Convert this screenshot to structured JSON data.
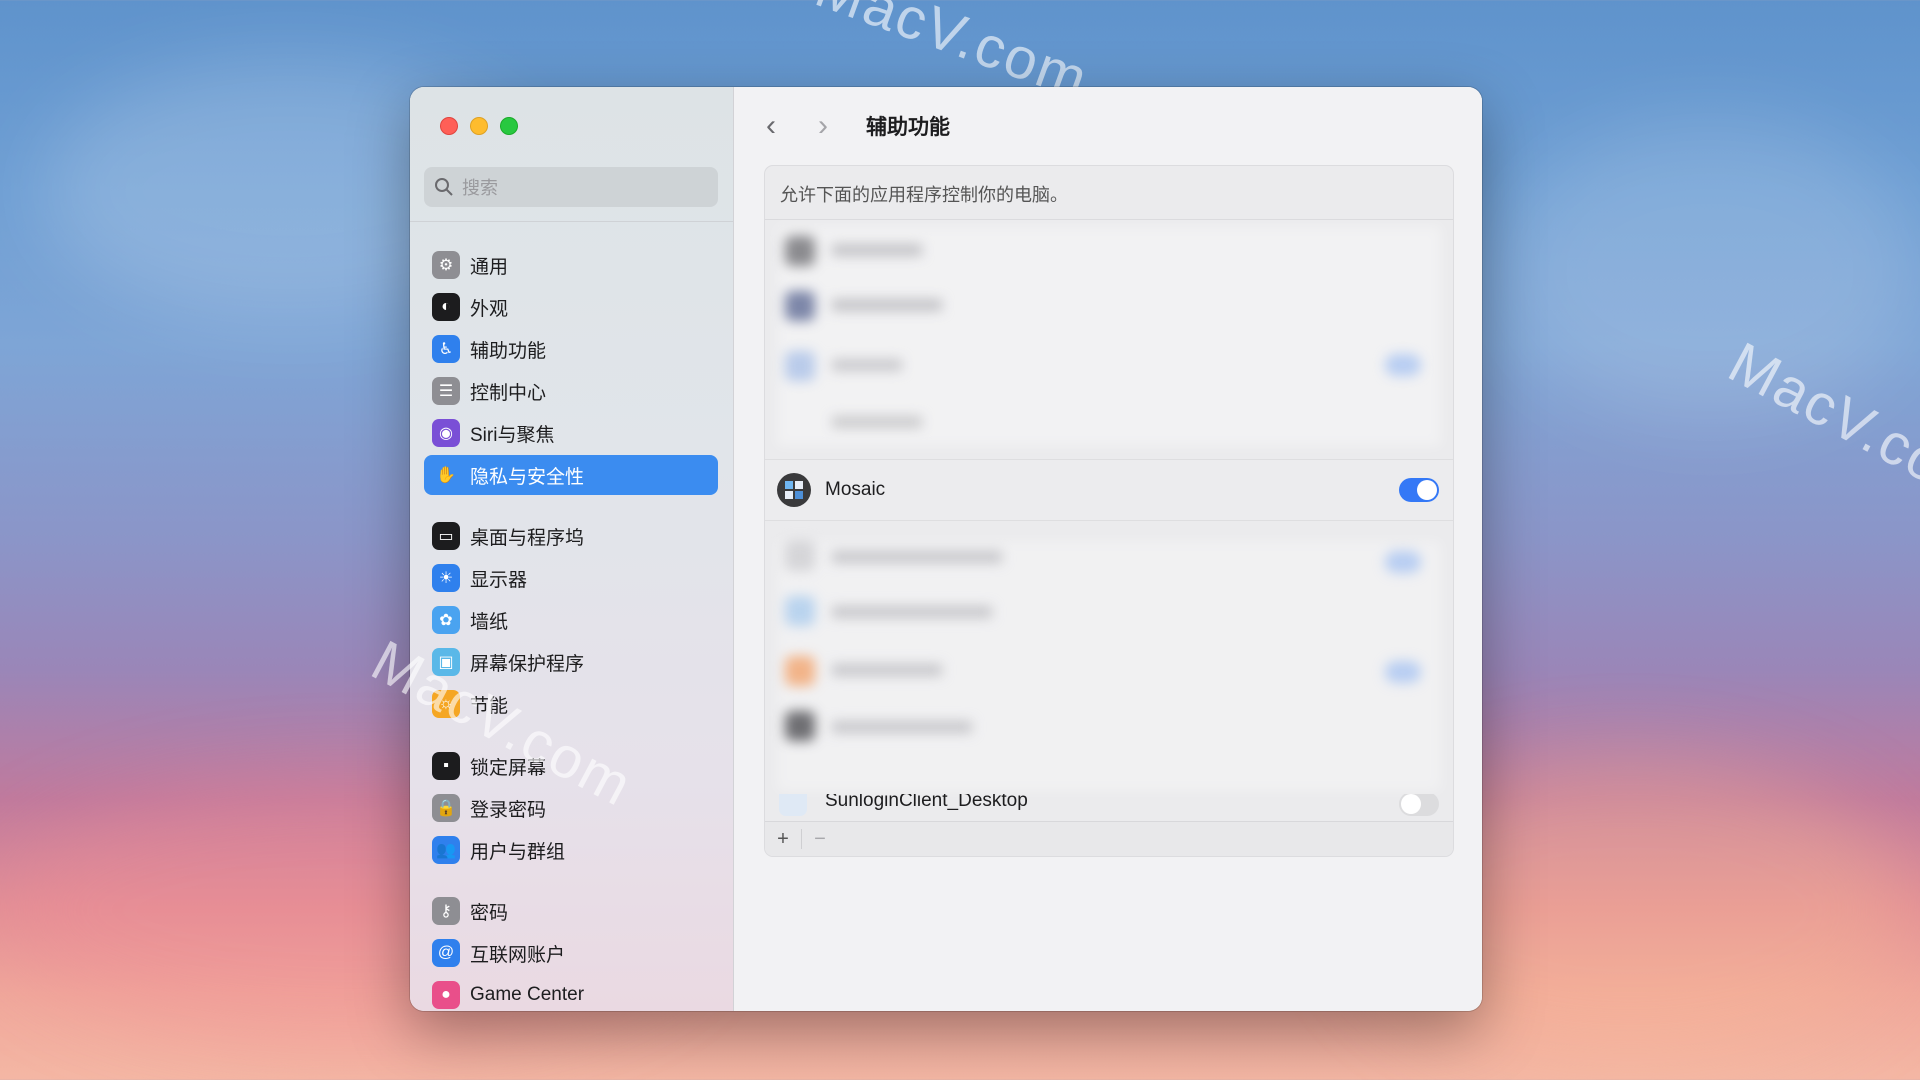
{
  "desktop": {
    "watermarks": [
      "MacV.com",
      "MacV.co",
      "MacV.com"
    ]
  },
  "window": {
    "search_placeholder": "搜索",
    "sidebar": [
      {
        "label": "通用",
        "icon": "gear-icon",
        "color": "#8e8e93"
      },
      {
        "label": "外观",
        "icon": "appearance-icon",
        "color": "#1c1c1e"
      },
      {
        "label": "辅助功能",
        "icon": "accessibility-icon",
        "color": "#2f80ed"
      },
      {
        "label": "控制中心",
        "icon": "control-center-icon",
        "color": "#8e8e93"
      },
      {
        "label": "Siri与聚焦",
        "icon": "siri-icon",
        "color": "#7a4fd6"
      },
      {
        "label": "隐私与安全性",
        "icon": "hand-icon",
        "color": "#3b8cf0",
        "active": true
      },
      {
        "label": "桌面与程序坞",
        "icon": "dock-icon",
        "color": "#1c1c1e"
      },
      {
        "label": "显示器",
        "icon": "brightness-icon",
        "color": "#2f80ed"
      },
      {
        "label": "墙纸",
        "icon": "wallpaper-icon",
        "color": "#4aa3f0"
      },
      {
        "label": "屏幕保护程序",
        "icon": "screensaver-icon",
        "color": "#5ab8e8"
      },
      {
        "label": "节能",
        "icon": "energy-icon",
        "color": "#f5a623"
      },
      {
        "label": "锁定屏幕",
        "icon": "lock-screen-icon",
        "color": "#1c1c1e"
      },
      {
        "label": "登录密码",
        "icon": "lock-icon",
        "color": "#8e8e93"
      },
      {
        "label": "用户与群组",
        "icon": "users-icon",
        "color": "#2f80ed"
      },
      {
        "label": "密码",
        "icon": "key-icon",
        "color": "#8e8e93"
      },
      {
        "label": "互联网账户",
        "icon": "at-icon",
        "color": "#2f80ed"
      },
      {
        "label": "Game Center",
        "icon": "game-center-icon",
        "color": "#e94f8a"
      }
    ]
  },
  "main": {
    "title": "辅助功能",
    "description": "允许下面的应用程序控制你的电脑。",
    "apps": [
      {
        "name": "Mosaic",
        "icon": "mosaic-icon",
        "enabled": true
      },
      {
        "name": "SunloginClient_Desktop",
        "icon": "sunlogin-icon",
        "enabled": false
      }
    ],
    "add_symbol": "+",
    "remove_symbol": "−"
  },
  "colors": {
    "accent": "#3b8cf0",
    "toggle_on": "#3478f6"
  }
}
